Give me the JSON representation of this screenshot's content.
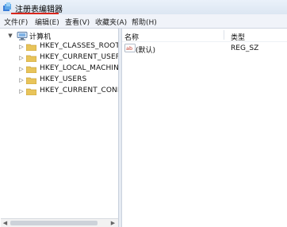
{
  "window": {
    "title": "注册表编辑器"
  },
  "menu": {
    "items": [
      "文件(F)",
      "编辑(E)",
      "查看(V)",
      "收藏夹(A)",
      "帮助(H)"
    ]
  },
  "tree": {
    "root": {
      "label": "计算机",
      "expander": "▼"
    },
    "children": [
      {
        "label": "HKEY_CLASSES_ROOT",
        "expander": "▷"
      },
      {
        "label": "HKEY_CURRENT_USER",
        "expander": "▷"
      },
      {
        "label": "HKEY_LOCAL_MACHIN",
        "expander": "▷"
      },
      {
        "label": "HKEY_USERS",
        "expander": "▷"
      },
      {
        "label": "HKEY_CURRENT_CONF",
        "expander": "▷"
      }
    ]
  },
  "list": {
    "columns": {
      "name": "名称",
      "type": "类型"
    },
    "rows": [
      {
        "icon": "ab",
        "name": "(默认)",
        "type": "REG_SZ"
      }
    ]
  },
  "scrollbar": {
    "left_arrow": "◀",
    "right_arrow": "▶"
  },
  "colors": {
    "title_underline": "#d9261c",
    "folder": "#e8c45a"
  }
}
